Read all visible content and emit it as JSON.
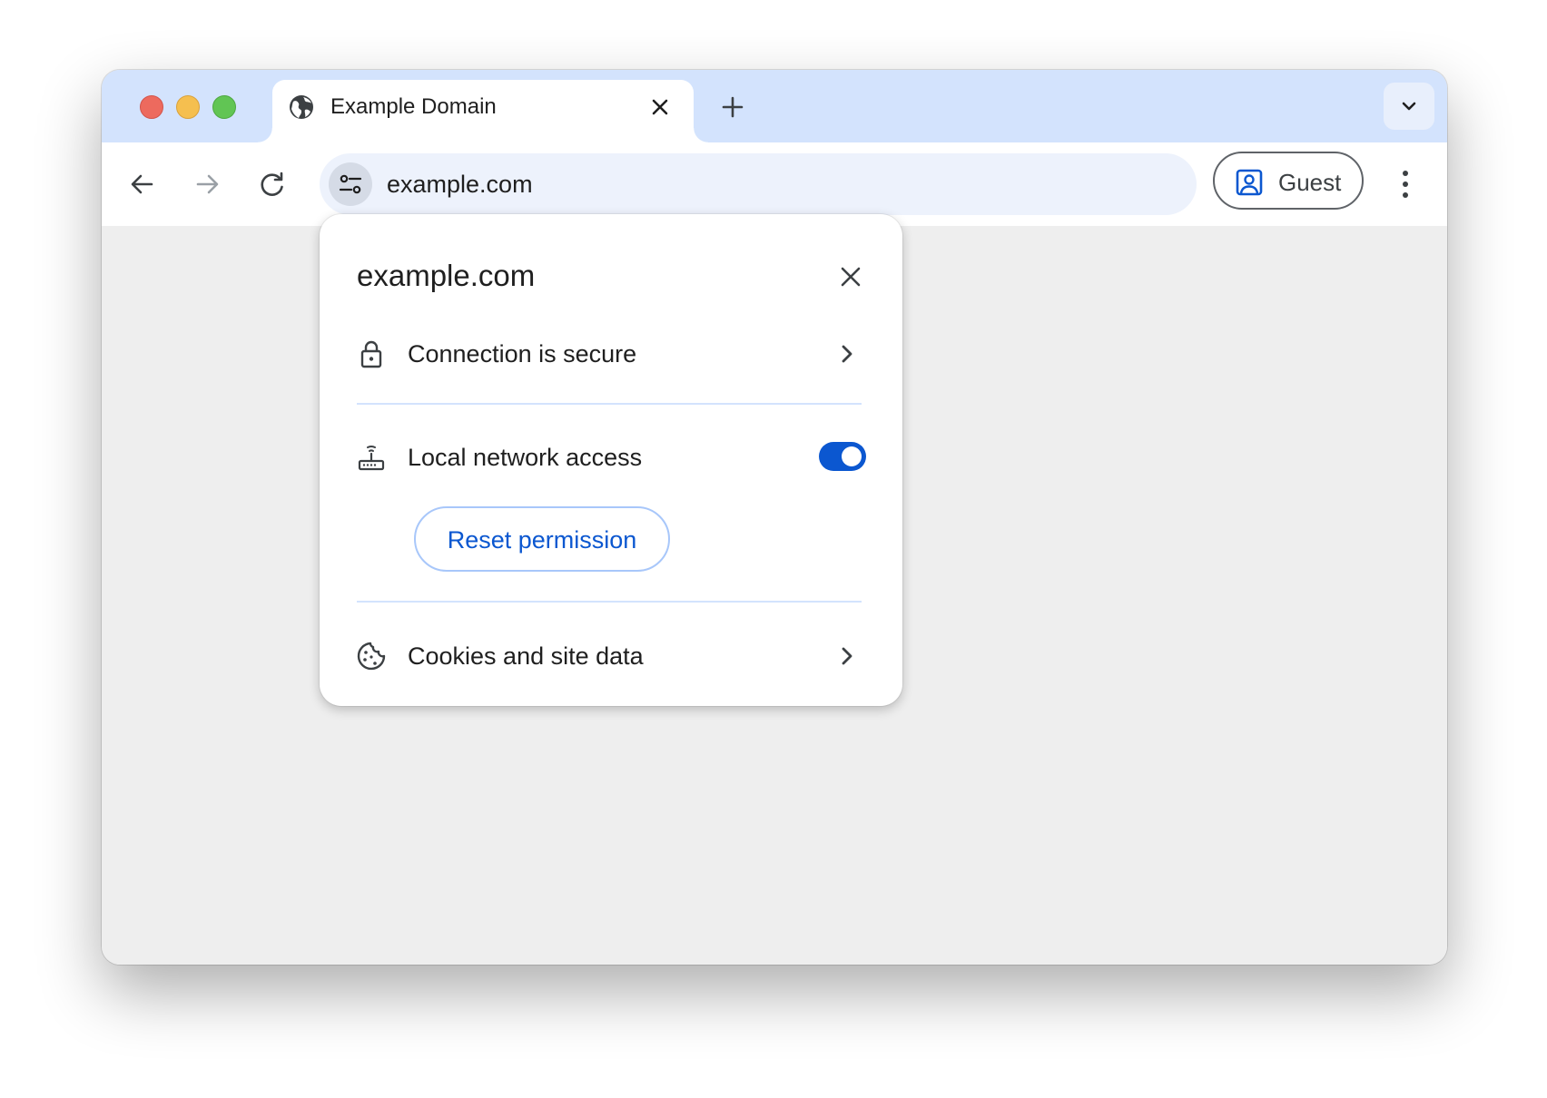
{
  "colors": {
    "tabstrip": "#d3e3fd",
    "accent": "#0b57d0",
    "omnibox": "#edf2fc",
    "content": "#eeeeee",
    "traffic_close": "#ed6a5e",
    "traffic_minimize": "#f5bf4f",
    "traffic_maximize": "#61c554"
  },
  "window": {
    "controls": [
      "close",
      "minimize",
      "maximize"
    ]
  },
  "tabs": [
    {
      "title": "Example Domain",
      "favicon": "globe-icon",
      "active": true
    }
  ],
  "toolbar": {
    "url": "example.com",
    "profile_label": "Guest",
    "icons": [
      "back-arrow-icon",
      "forward-arrow-icon",
      "reload-icon",
      "tune-icon",
      "profile-icon",
      "more-vert-icon"
    ]
  },
  "page_info": {
    "title": "example.com",
    "items": [
      {
        "label": "Connection is secure",
        "icon": "lock-icon",
        "has_chevron": true
      },
      {
        "label": "Local network access",
        "icon": "router-icon",
        "toggle_on": true
      },
      {
        "label": "Cookies and site data",
        "icon": "cookie-icon",
        "has_chevron": true
      }
    ],
    "reset_label": "Reset permission"
  }
}
